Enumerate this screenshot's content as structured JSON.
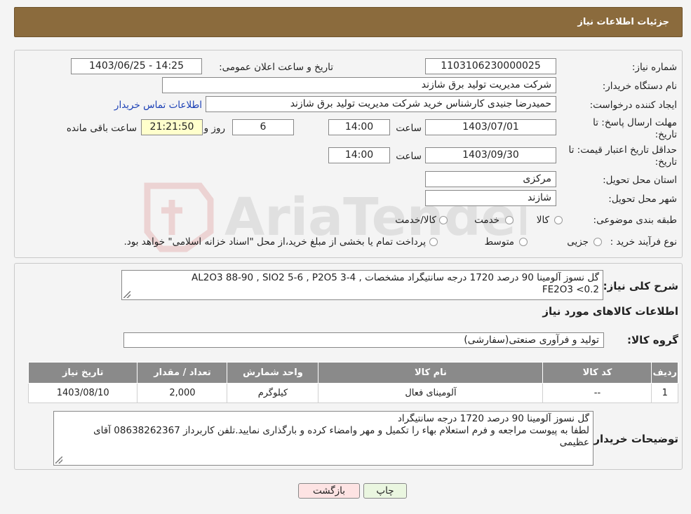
{
  "header": {
    "title": "جزئیات اطلاعات نیاز"
  },
  "info": {
    "need_number_label": "شماره نیاز:",
    "need_number": "1103106230000025",
    "announce_label": "تاریخ و ساعت اعلان عمومی:",
    "announce_value": "1403/06/25 - 14:25",
    "buyer_org_label": "نام دستگاه خریدار:",
    "buyer_org": "شرکت مدیریت تولید برق شازند",
    "creator_label": "ایجاد کننده درخواست:",
    "creator": "حمیدرضا جنیدی کارشناس خرید شرکت مدیریت تولید برق شازند",
    "contact_link": "اطلاعات تماس خریدار",
    "deadline_label_1": "مهلت ارسال پاسخ: تا",
    "deadline_label_2": "تاریخ:",
    "deadline_date": "1403/07/01",
    "time_label": "ساعت",
    "deadline_time": "14:00",
    "days_value": "6",
    "days_label": "روز و",
    "remaining_time": "21:21:50",
    "remaining_label": "ساعت باقی مانده",
    "price_validity_label_1": "حداقل تاریخ اعتبار قیمت: تا",
    "price_validity_label_2": "تاریخ:",
    "price_validity_date": "1403/09/30",
    "price_validity_time": "14:00",
    "province_label": "استان محل تحویل:",
    "province": "مرکزی",
    "city_label": "شهر محل تحویل:",
    "city": "شازند",
    "category_label": "طبقه بندی موضوعی:",
    "category_options": [
      "کالا",
      "خدمت",
      "کالا/خدمت"
    ],
    "process_label": "نوع فرآیند خرید :",
    "process_options": [
      "جزیی",
      "متوسط"
    ],
    "process_note": "پرداخت تمام یا بخشی از مبلغ خرید،از محل \"اسناد خزانه اسلامی\" خواهد بود."
  },
  "summary": {
    "label": "شرح کلی نیاز:",
    "line1": "گل نسوز آلومینا 90 درصد  1720 درجه سانتیگراد         مشخصات   ,  AL2O3 88-90 , SIO2 5-6 , P2O5 3-4",
    "line2": "FE2O3 <0.2",
    "goods_info_title": "اطلاعات کالاهای مورد نیاز",
    "group_label": "گروه کالا:",
    "group_value": "تولید و فرآوری صنعتی(سفارشی)"
  },
  "table": {
    "headers": [
      "ردیف",
      "کد کالا",
      "نام کالا",
      "واحد شمارش",
      "تعداد / مقدار",
      "تاریخ نیاز"
    ],
    "rows": [
      [
        "1",
        "--",
        "آلومینای فعال",
        "کیلوگرم",
        "2,000",
        "1403/08/10"
      ]
    ]
  },
  "notes": {
    "label": "توضیحات خریدار:",
    "line1": "گل نسوز آلومینا 90 درصد 1720 درجه سانتیگراد",
    "line2": "لطفا به پیوست مراجعه و فرم استعلام بهاء را تکمیل و مهر وامضاء کرده و بارگذاری نمایید.تلفن کاربرداز 08638262367 آقای",
    "line3": "عظیمی"
  },
  "buttons": {
    "print": "چاپ",
    "back": "بازگشت"
  },
  "watermark": "AriaTender.neT",
  "colors": {
    "header": "#8b6b3d",
    "table_header": "#8a8a8a",
    "back_button": "#fde3e3",
    "print_button": "#eaf6e0",
    "remaining": "#ffffcc"
  }
}
